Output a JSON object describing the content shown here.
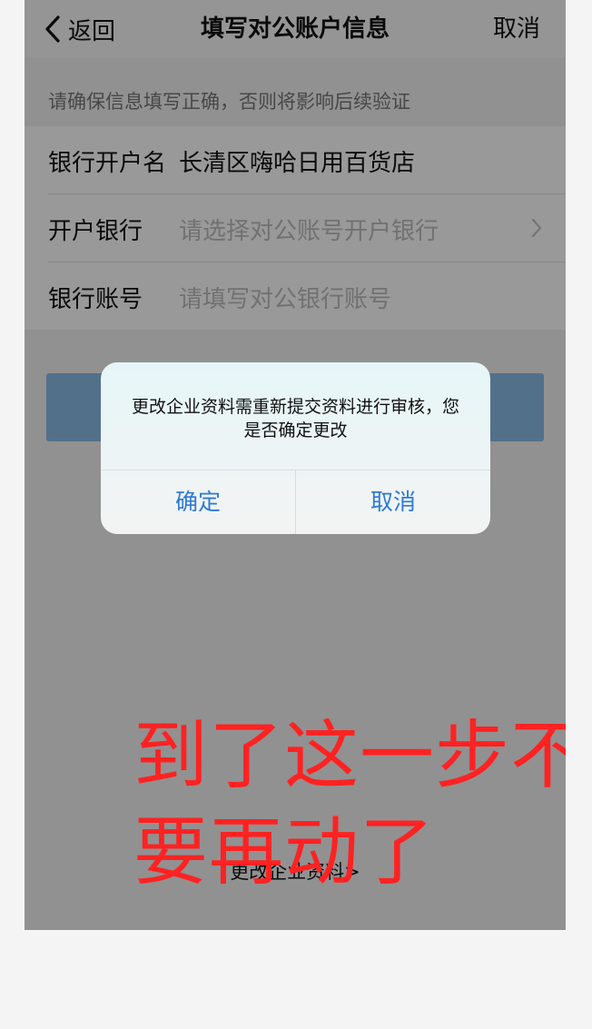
{
  "nav": {
    "back_label": "返回",
    "title": "填写对公账户信息",
    "cancel_label": "取消"
  },
  "notice": "请确保信息填写正确，否则将影响后续验证",
  "form": {
    "rows": [
      {
        "label": "银行开户名",
        "value": "长清区嗨哈日用百货店"
      },
      {
        "label": "开户银行",
        "placeholder": "请选择对公账号开户银行"
      },
      {
        "label": "银行账号",
        "placeholder": "请填写对公银行账号"
      }
    ]
  },
  "footer_link": "更改企业资料>",
  "dialog": {
    "message": "更改企业资料需重新提交资料进行审核，您是否确定更改",
    "confirm_label": "确定",
    "cancel_label": "取消"
  },
  "annotation": "到了这一步不要再动了",
  "colors": {
    "accent": "#2d7ad6",
    "annotation": "#ff2222",
    "submit_button": "#8bbbe8"
  },
  "icons": {
    "back": "chevron-left-icon",
    "row_arrow": "chevron-right-icon"
  }
}
